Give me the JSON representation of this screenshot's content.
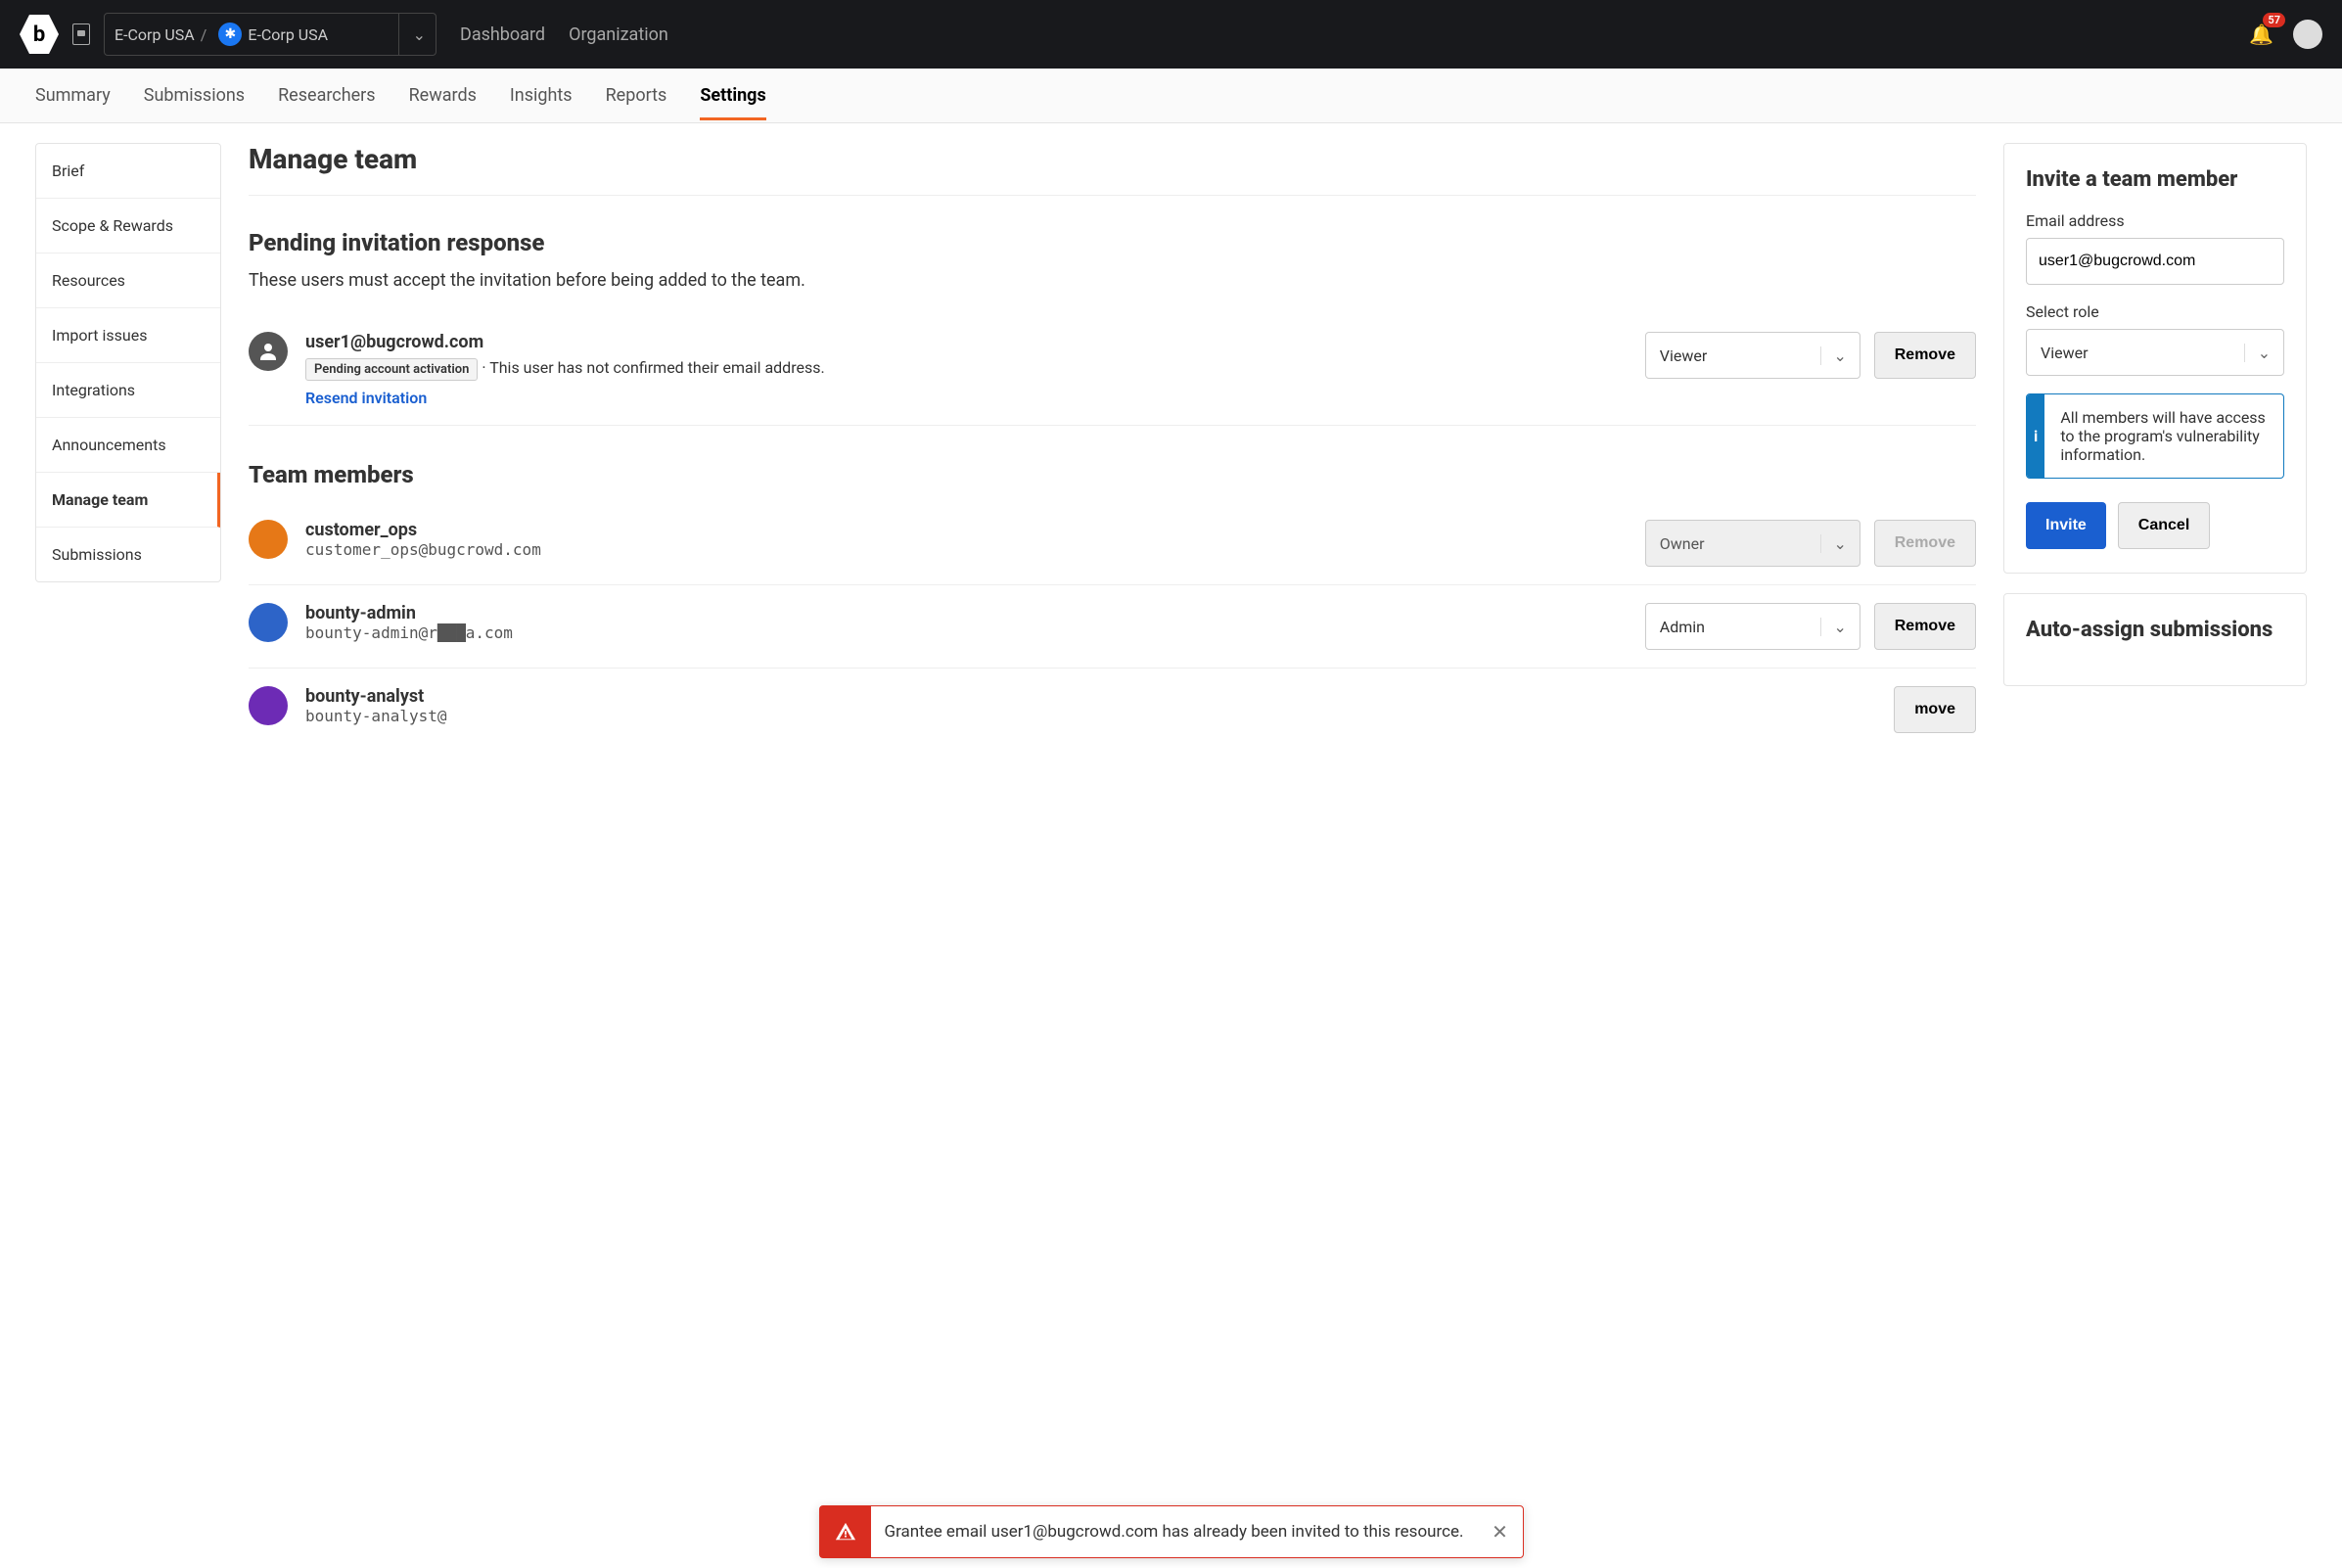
{
  "topbar": {
    "breadcrumb_org": "E-Corp USA",
    "breadcrumb_sep": "/",
    "breadcrumb_program": "E-Corp USA",
    "nav": {
      "dashboard": "Dashboard",
      "organization": "Organization"
    },
    "notification_count": "57"
  },
  "subnav": {
    "items": [
      "Summary",
      "Submissions",
      "Researchers",
      "Rewards",
      "Insights",
      "Reports",
      "Settings"
    ],
    "active": "Settings"
  },
  "sidebar": {
    "items": [
      "Brief",
      "Scope & Rewards",
      "Resources",
      "Import issues",
      "Integrations",
      "Announcements",
      "Manage team",
      "Submissions"
    ],
    "active": "Manage team"
  },
  "page": {
    "title": "Manage team",
    "pending": {
      "heading": "Pending invitation response",
      "description": "These users must accept the invitation before being added to the team.",
      "user": {
        "email": "user1@bugcrowd.com",
        "status_pill": "Pending account activation",
        "status_text": " ·  This user has not confirmed their email address.",
        "resend": "Resend invitation",
        "role": "Viewer",
        "remove": "Remove"
      }
    },
    "team": {
      "heading": "Team members",
      "members": [
        {
          "name": "customer_ops",
          "email": "customer_ops@bugcrowd.com",
          "role": "Owner",
          "remove": "Remove"
        },
        {
          "name": "bounty-admin",
          "email": "bounty-admin@r███a.com",
          "role": "Admin",
          "remove": "Remove"
        },
        {
          "name": "bounty-analyst",
          "email": "bounty-analyst@",
          "role": "",
          "remove": "   move"
        }
      ]
    }
  },
  "invite": {
    "heading": "Invite a team member",
    "email_label": "Email address",
    "email_value": "user1@bugcrowd.com",
    "role_label": "Select role",
    "role_value": "Viewer",
    "info": "All members will have access to the program's vulnerability information.",
    "invite_btn": "Invite",
    "cancel_btn": "Cancel"
  },
  "autoassign": {
    "heading": "Auto-assign submissions"
  },
  "toast": {
    "message": "Grantee email user1@bugcrowd.com has already been invited to this resource."
  }
}
